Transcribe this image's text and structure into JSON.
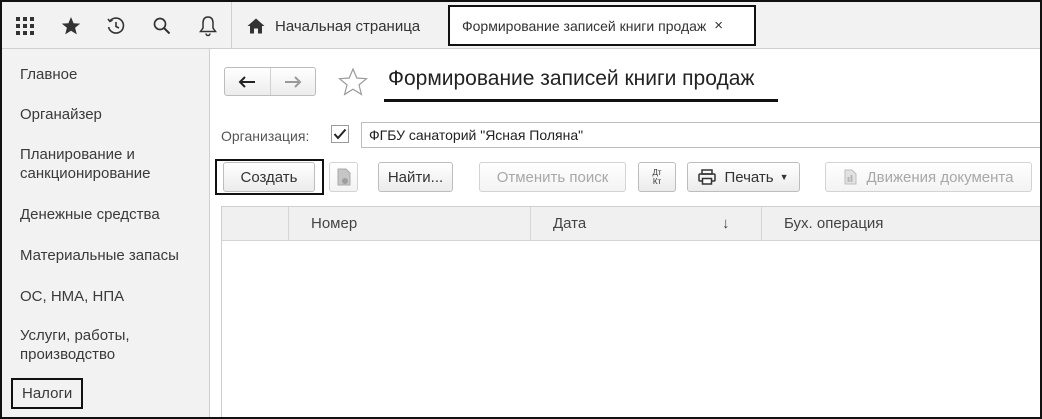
{
  "topbar": {
    "icons": [
      "apps-grid-icon",
      "favorites-star-icon",
      "history-icon",
      "search-icon",
      "notifications-bell-icon"
    ]
  },
  "tabs": {
    "home": {
      "label": "Начальная страница",
      "icon": "home-icon"
    },
    "active": {
      "label": "Формирование записей книги продаж",
      "close": "×"
    }
  },
  "sidebar": {
    "items": [
      {
        "label": "Главное"
      },
      {
        "label": "Органайзер"
      },
      {
        "label": "Планирование и\nсанкционирование"
      },
      {
        "label": "Денежные средства"
      },
      {
        "label": "Материальные запасы"
      },
      {
        "label": "ОС, НМА, НПА"
      },
      {
        "label": "Услуги, работы,\nпроизводство"
      },
      {
        "label": "Налоги",
        "highlighted": true
      }
    ]
  },
  "document": {
    "title": "Формирование записей книги продаж",
    "org_label": "Организация:",
    "org_checked": true,
    "org_value": "ФГБУ санаторий \"Ясная Поляна\""
  },
  "toolbar": {
    "create": "Создать",
    "find": "Найти...",
    "cancel_search": "Отменить поиск",
    "dtkt_top": "Дт",
    "dtkt_bottom": "Кт",
    "print": "Печать",
    "moves": "Движения документа"
  },
  "table": {
    "columns": [
      "",
      "Номер",
      "Дата",
      "Бух. операция"
    ],
    "sort_indicator": "↓"
  }
}
